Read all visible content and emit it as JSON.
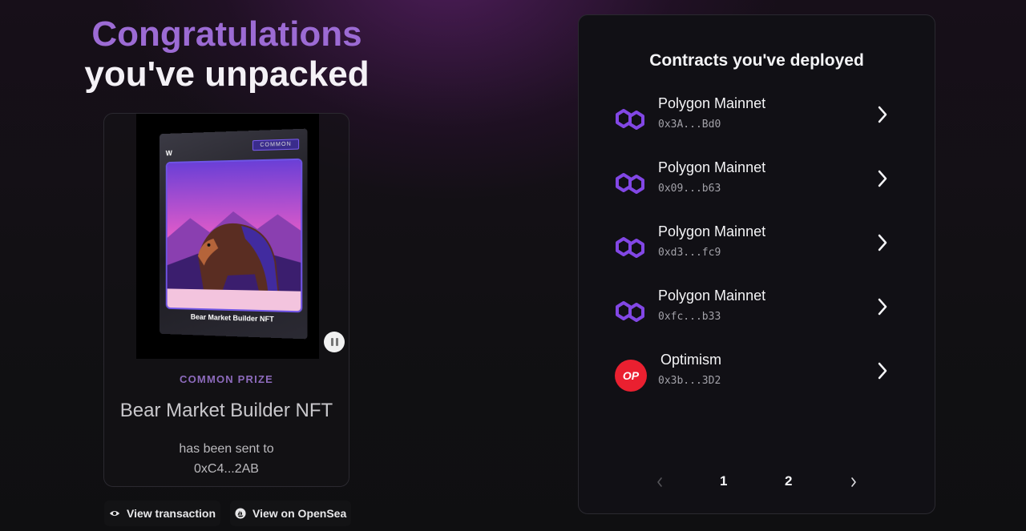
{
  "hero": {
    "line1": "Congratulations",
    "line2": "you've unpacked"
  },
  "nft": {
    "pack_tag": "COMMON",
    "pack_logo": "W",
    "pack_title": "Bear Market Builder NFT",
    "prize_label": "COMMON PRIZE",
    "name": "Bear Market Builder NFT",
    "sent_line": "has been sent to",
    "recipient": "0xC4...2AB"
  },
  "links": {
    "view_transaction": "View transaction",
    "view_opensea": "View on OpenSea"
  },
  "contracts": {
    "title": "Contracts you've deployed",
    "items": [
      {
        "chain": "Polygon Mainnet",
        "address": "0x3A...Bd0",
        "icon": "polygon-icon"
      },
      {
        "chain": "Polygon Mainnet",
        "address": "0x09...b63",
        "icon": "polygon-icon"
      },
      {
        "chain": "Polygon Mainnet",
        "address": "0xd3...fc9",
        "icon": "polygon-icon"
      },
      {
        "chain": "Polygon Mainnet",
        "address": "0xfc...b33",
        "icon": "polygon-icon"
      },
      {
        "chain": "Optimism",
        "address": "0x3b...3D2",
        "icon": "optimism-icon",
        "badge": "OP"
      }
    ],
    "pagination": {
      "pages": [
        "1",
        "2"
      ],
      "current": "1"
    }
  },
  "colors": {
    "polygon": "#8247e5",
    "optimism": "#ea2030",
    "accent": "#9c6bd4"
  }
}
